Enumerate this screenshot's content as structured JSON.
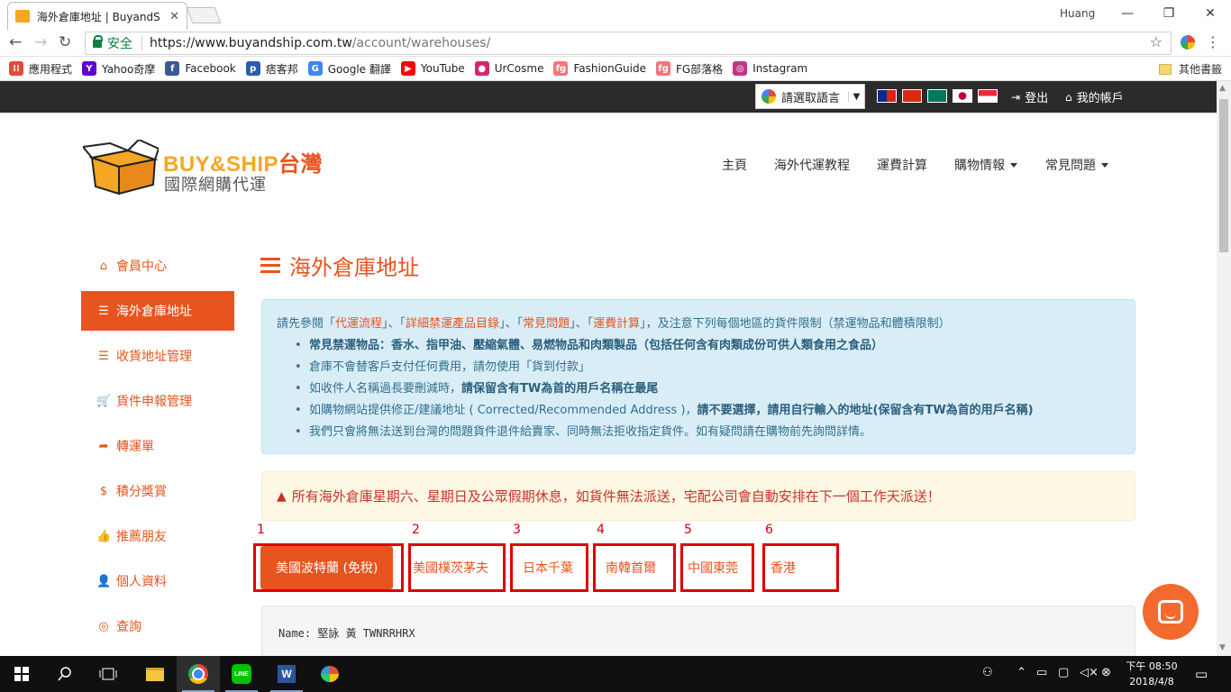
{
  "browser": {
    "tab_title": "海外倉庫地址 | BuyandS",
    "tab_close": "✕",
    "user": "Huang",
    "secure_label": "安全",
    "url_host": "https://www.buyandship.com.tw",
    "url_path": "/account/warehouses/",
    "bookmarks": [
      {
        "label": "應用程式",
        "color": "#e04b3c"
      },
      {
        "label": "Yahoo奇摩",
        "color": "#5f01d1"
      },
      {
        "label": "Facebook",
        "color": "#3b5998"
      },
      {
        "label": "痞客邦",
        "color": "#2a5db0"
      },
      {
        "label": "Google 翻譯",
        "color": "#4285f4"
      },
      {
        "label": "YouTube",
        "color": "#ff0000"
      },
      {
        "label": "UrCosme",
        "color": "#d6246e"
      },
      {
        "label": "FashionGuide",
        "color": "#f4747a"
      },
      {
        "label": "FG部落格",
        "color": "#f4747a"
      },
      {
        "label": "Instagram",
        "color": "#c13584"
      }
    ],
    "other_bookmarks": "其他書籤"
  },
  "topbar": {
    "translate_label": "請選取語言",
    "logout": "登出",
    "my_account": "我的帳戶"
  },
  "logo": {
    "brand_a": "BUY&SHIP",
    "brand_b": "台灣",
    "subtitle": "國際網購代運"
  },
  "nav": [
    "主頁",
    "海外代運教程",
    "運費計算",
    "購物情報",
    "常見問題"
  ],
  "sidebar": [
    {
      "label": "會員中心",
      "icon": "⌂"
    },
    {
      "label": "海外倉庫地址",
      "icon": "☰"
    },
    {
      "label": "收貨地址管理",
      "icon": "☰"
    },
    {
      "label": "貨件申報管理",
      "icon": "🛒"
    },
    {
      "label": "轉運單",
      "icon": "➦"
    },
    {
      "label": "積分獎賞",
      "icon": "$"
    },
    {
      "label": "推薦朋友",
      "icon": "👍"
    },
    {
      "label": "個人資料",
      "icon": "👤"
    },
    {
      "label": "查詢",
      "icon": "◎"
    }
  ],
  "page": {
    "title": "海外倉庫地址",
    "info_intro_a": "請先參閱「",
    "info_link_1": "代運流程",
    "info_sep_1": "」、「",
    "info_link_2": "詳細禁運產品目錄",
    "info_sep_2": "」、「",
    "info_link_3": "常見問題",
    "info_sep_3": "」、「",
    "info_link_4": "運費計算",
    "info_intro_b": "」，及注意下列每個地區的貨件限制（禁運物品和體積限制）",
    "bullet_1": "常見禁運物品：香水、指甲油、壓縮氣體、易燃物品和肉類製品（包括任何含有肉類成份可供人類食用之食品）",
    "bullet_2": "倉庫不會替客戶支付任何費用，請勿使用「貨到付款」",
    "bullet_3a": "如收件人名稱過長要刪減時，",
    "bullet_3b": "請保留含有TW為首的用戶名稱在最尾",
    "bullet_4a": "如購物網站提供修正/建議地址 ( Corrected/Recommended Address )，",
    "bullet_4b": "請不要選擇，請用自行輸入的地址(保留含有TW為首的用戶名稱)",
    "bullet_5": "我們只會將無法送到台灣的問題貨件退件給賣家、同時無法拒收指定貨件。如有疑問請在購物前先詢問詳情。",
    "warning": "所有海外倉庫星期六、星期日及公眾假期休息，如貨件無法派送，宅配公司會自動安排在下一個工作天派送！",
    "tab_numbers": [
      "1",
      "2",
      "3",
      "4",
      "5",
      "6"
    ],
    "tabs": [
      "美國波特蘭 (免稅)",
      "美國樸茨茅夫",
      "日本千葉",
      "南韓首爾",
      "中國東莞",
      "香港"
    ],
    "address_line": "Name: 堅詠 黃 TWNRRHRX"
  },
  "taskbar": {
    "time": "下午 08:50",
    "date": "2018/4/8"
  }
}
